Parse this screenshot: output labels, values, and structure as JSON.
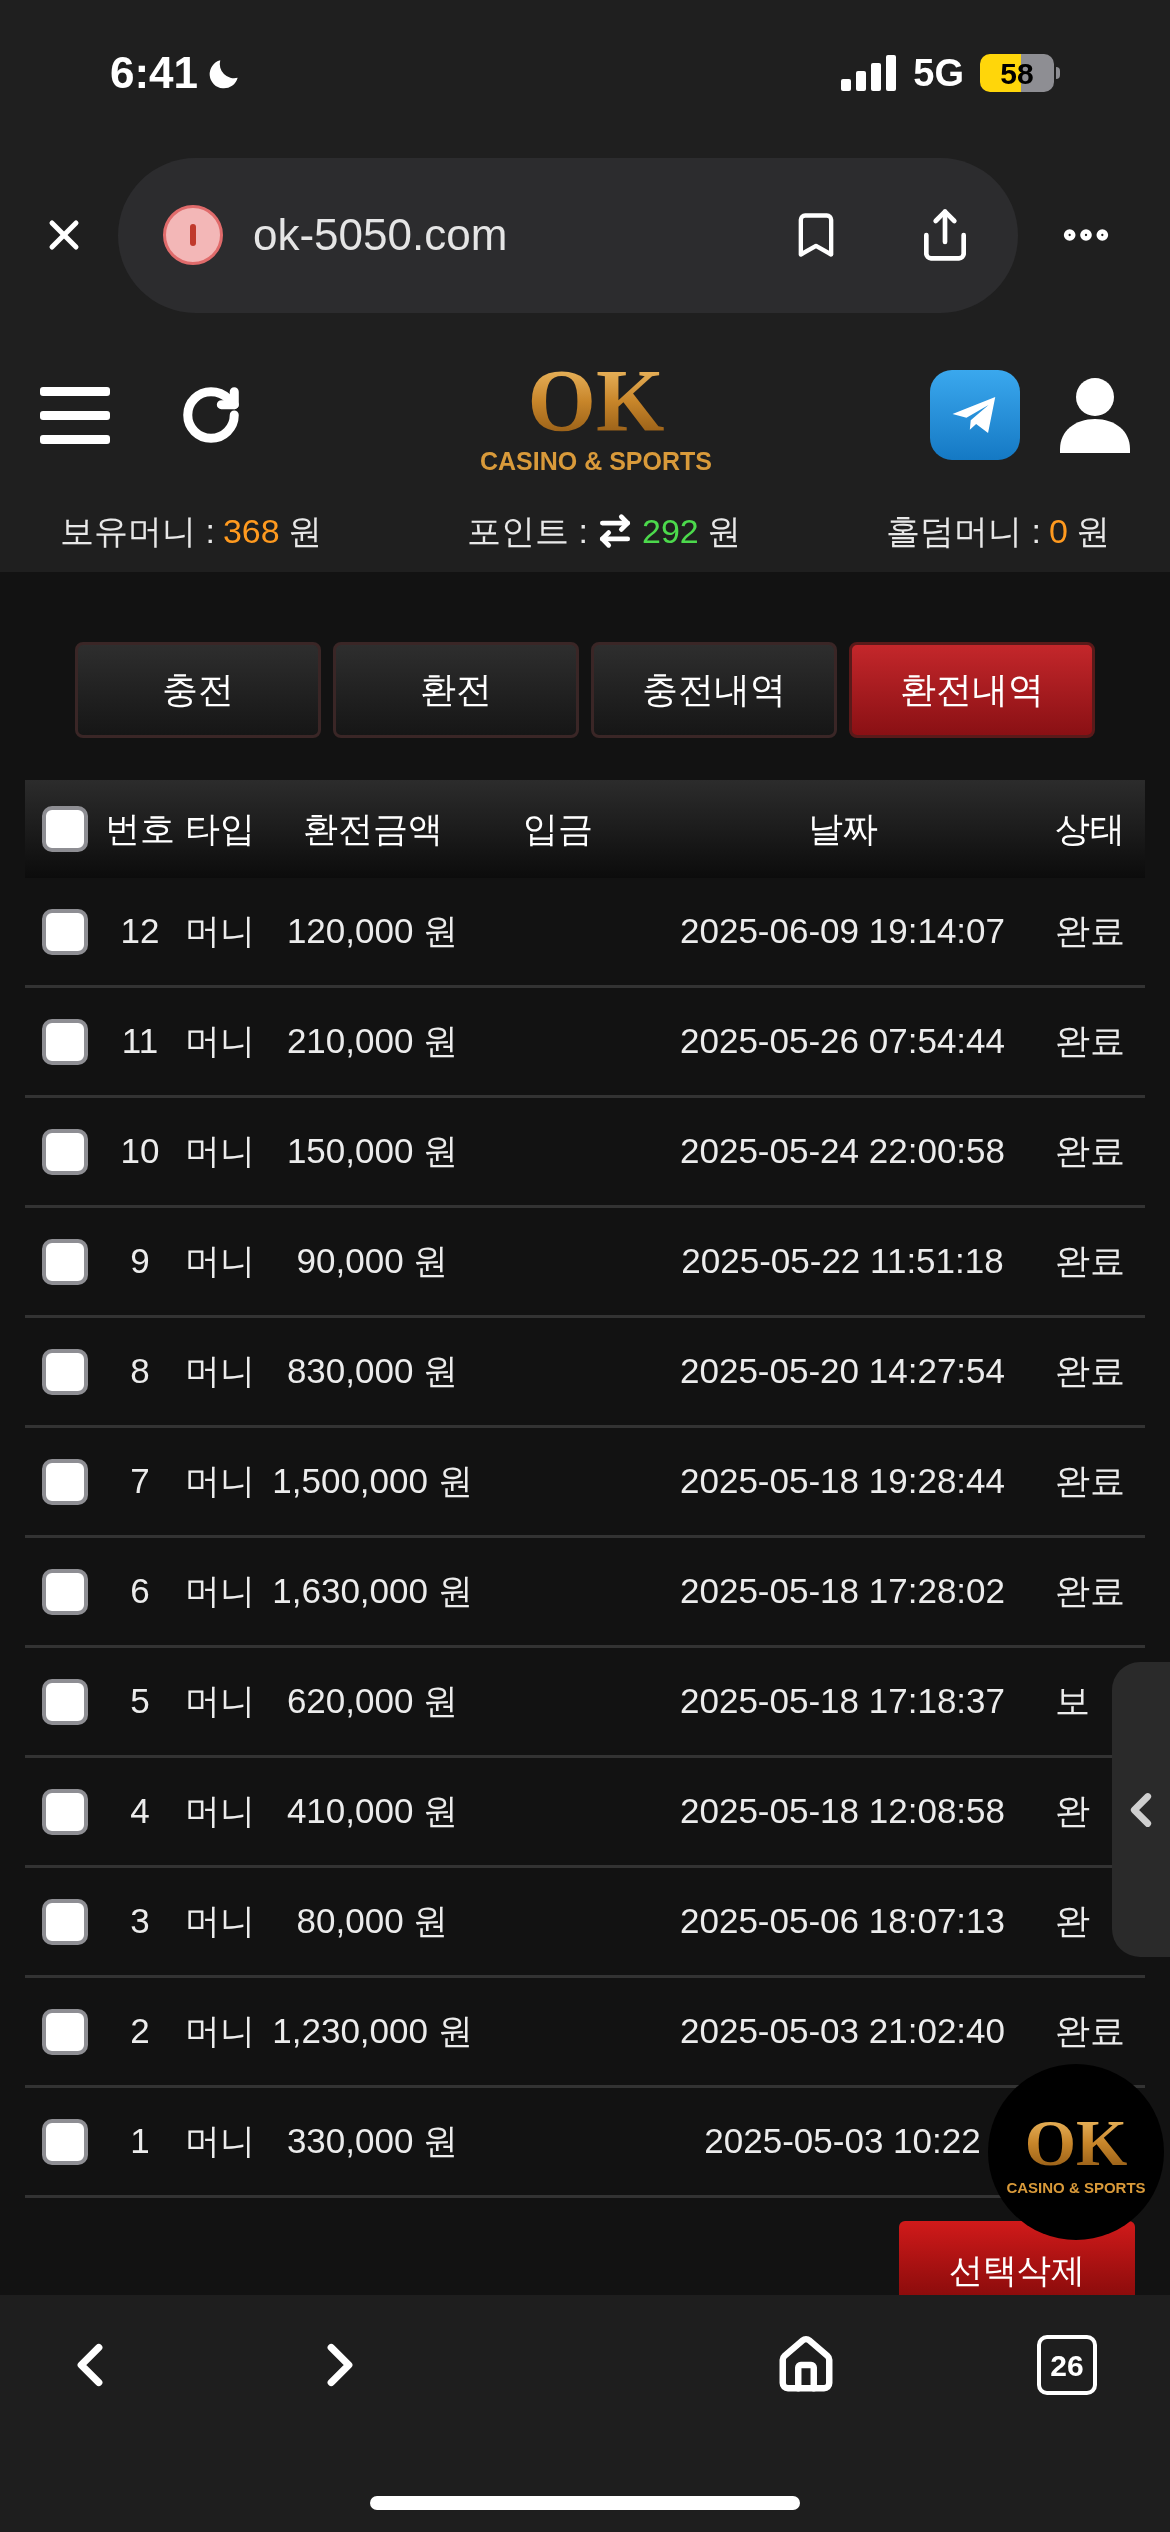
{
  "status_bar": {
    "time": "6:41",
    "network": "5G",
    "battery": "58"
  },
  "browser": {
    "url": "ok-5050.com",
    "tab_count": "26"
  },
  "logo": {
    "mark": "OK",
    "tagline": "CASINO & SPORTS"
  },
  "balances": [
    {
      "label": "보유머니 :",
      "value": "368",
      "unit": "원",
      "color": "#ff9a1f",
      "kind": "plain"
    },
    {
      "label": "포인트 :",
      "value": "292",
      "unit": "원",
      "color": "#4cd94c",
      "kind": "exchange"
    },
    {
      "label": "홀덤머니 :",
      "value": "0",
      "unit": "원",
      "color": "#ff9a1f",
      "kind": "plain"
    }
  ],
  "tabs": [
    {
      "label": "충전",
      "selected": false
    },
    {
      "label": "환전",
      "selected": false
    },
    {
      "label": "충전내역",
      "selected": false
    },
    {
      "label": "환전내역",
      "selected": true
    }
  ],
  "table": {
    "select_all": false,
    "columns": [
      "번호",
      "타입",
      "환전금액",
      "입금",
      "날짜",
      "상태"
    ],
    "rows": [
      {
        "checked": false,
        "no": "12",
        "type": "머니",
        "amount": "120,000 원",
        "date": "2025-06-09 19:14:07",
        "status": "완료"
      },
      {
        "checked": false,
        "no": "11",
        "type": "머니",
        "amount": "210,000 원",
        "date": "2025-05-26 07:54:44",
        "status": "완료"
      },
      {
        "checked": false,
        "no": "10",
        "type": "머니",
        "amount": "150,000 원",
        "date": "2025-05-24 22:00:58",
        "status": "완료"
      },
      {
        "checked": false,
        "no": "9",
        "type": "머니",
        "amount": "90,000 원",
        "date": "2025-05-22 11:51:18",
        "status": "완료"
      },
      {
        "checked": false,
        "no": "8",
        "type": "머니",
        "amount": "830,000 원",
        "date": "2025-05-20 14:27:54",
        "status": "완료"
      },
      {
        "checked": false,
        "no": "7",
        "type": "머니",
        "amount": "1,500,000 원",
        "date": "2025-05-18 19:28:44",
        "status": "완료"
      },
      {
        "checked": false,
        "no": "6",
        "type": "머니",
        "amount": "1,630,000 원",
        "date": "2025-05-18 17:28:02",
        "status": "완료"
      },
      {
        "checked": false,
        "no": "5",
        "type": "머니",
        "amount": "620,000 원",
        "date": "2025-05-18 17:18:37",
        "status": "보"
      },
      {
        "checked": false,
        "no": "4",
        "type": "머니",
        "amount": "410,000 원",
        "date": "2025-05-18 12:08:58",
        "status": "완"
      },
      {
        "checked": false,
        "no": "3",
        "type": "머니",
        "amount": "80,000 원",
        "date": "2025-05-06 18:07:13",
        "status": "완"
      },
      {
        "checked": false,
        "no": "2",
        "type": "머니",
        "amount": "1,230,000 원",
        "date": "2025-05-03 21:02:40",
        "status": "완료"
      },
      {
        "checked": false,
        "no": "1",
        "type": "머니",
        "amount": "330,000 원",
        "date": "2025-05-03 10:22"
      }
    ]
  },
  "delete_button": "선택삭제",
  "floating_logo": {
    "mark": "OK",
    "tagline": "CASINO & SPORTS"
  }
}
